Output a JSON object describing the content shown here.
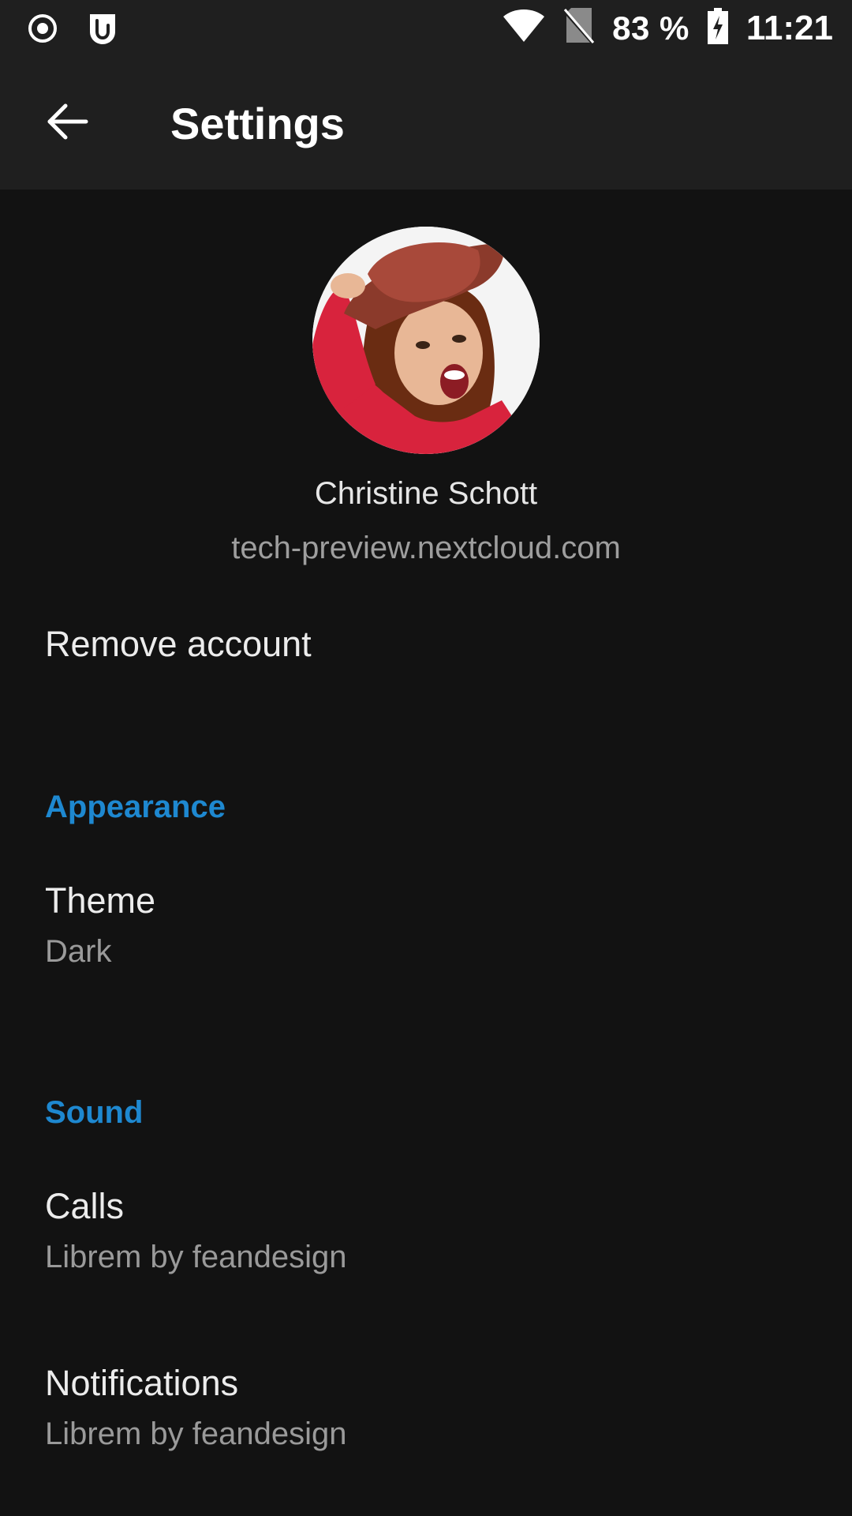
{
  "status_bar": {
    "left_icons": [
      "record-icon",
      "shield-u-icon"
    ],
    "right_icons": [
      "wifi-icon",
      "no-sim-icon",
      "battery-charging-icon"
    ],
    "battery": "83 %",
    "time": "11:21"
  },
  "app_bar": {
    "back_icon": "arrow-back-icon",
    "title": "Settings"
  },
  "profile": {
    "name": "Christine Schott",
    "server": "tech-preview.nextcloud.com"
  },
  "account": {
    "remove_label": "Remove account"
  },
  "appearance": {
    "header": "Appearance",
    "theme_title": "Theme",
    "theme_value": "Dark"
  },
  "sound": {
    "header": "Sound",
    "calls_title": "Calls",
    "calls_value": "Librem by feandesign",
    "notifications_title": "Notifications",
    "notifications_value": "Librem by feandesign"
  },
  "colors": {
    "accent": "#1e88d0",
    "background": "#121212",
    "toolbar": "#1f1f1f"
  }
}
